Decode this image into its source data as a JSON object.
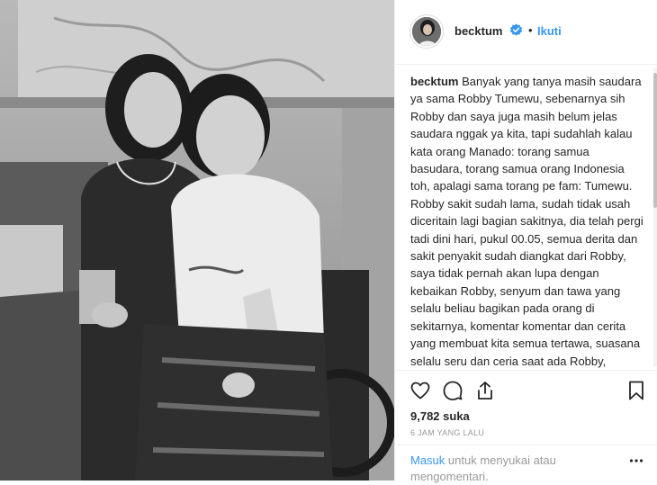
{
  "post": {
    "username": "becktum",
    "separator": "•",
    "follow_label": "Ikuti",
    "caption": "Banyak yang tanya masih saudara ya sama Robby Tumewu, sebenarnya sih Robby dan saya juga masih belum jelas saudara nggak ya kita, tapi sudahlah kalau kata orang Manado: torang samua basudara, torang samua orang Indonesia toh, apalagi sama torang pe fam: Tumewu. Robby sakit sudah lama, sudah tidak usah diceritain lagi bagian sakitnya, dia telah pergi tadi dini hari, pukul 00.05, semua derita dan sakit penyakit sudah diangkat dari Robby, saya tidak pernah akan lupa dengan kebaikan Robby, senyum dan tawa yang selalu beliau bagikan pada orang di sekitarnya, komentar komentar dan cerita yang membuat kita semua tertawa, suasana selalu seru dan ceria saat ada Robby, syuting panjangpun tidak terasa. Robby juga sempat menjadi fasilitator di Talkinc. Beliau adalah fasilitator kelas Total Look",
    "likes": "9,782 suka",
    "time_ago": "6 JAM YANG LALU",
    "login_link": "Masuk",
    "login_rest": " untuk menyukai atau mengomentari."
  },
  "icons": {
    "verified": "verified-badge-icon",
    "like": "heart-icon",
    "comment": "comment-bubble-icon",
    "share": "share-icon",
    "save": "bookmark-icon",
    "more": "more-dots-icon"
  },
  "colors": {
    "link": "#3897f0",
    "muted": "#999999",
    "text": "#262626"
  }
}
